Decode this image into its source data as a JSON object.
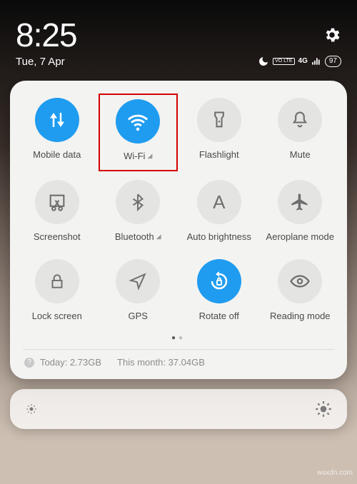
{
  "status": {
    "time": "8:25",
    "date": "Tue, 7 Apr",
    "volte": "VO LTE",
    "signal": "4G",
    "battery": "97"
  },
  "tiles": [
    {
      "label": "Mobile data",
      "active": true,
      "expand": false,
      "highlight": false
    },
    {
      "label": "Wi-Fi",
      "active": true,
      "expand": true,
      "highlight": true
    },
    {
      "label": "Flashlight",
      "active": false,
      "expand": false,
      "highlight": false
    },
    {
      "label": "Mute",
      "active": false,
      "expand": false,
      "highlight": false
    },
    {
      "label": "Screenshot",
      "active": false,
      "expand": false,
      "highlight": false
    },
    {
      "label": "Bluetooth",
      "active": false,
      "expand": true,
      "highlight": false
    },
    {
      "label": "Auto brightness",
      "active": false,
      "expand": false,
      "highlight": false
    },
    {
      "label": "Aeroplane mode",
      "active": false,
      "expand": false,
      "highlight": false
    },
    {
      "label": "Lock screen",
      "active": false,
      "expand": false,
      "highlight": false
    },
    {
      "label": "GPS",
      "active": false,
      "expand": false,
      "highlight": false
    },
    {
      "label": "Rotate off",
      "active": true,
      "expand": false,
      "highlight": false
    },
    {
      "label": "Reading mode",
      "active": false,
      "expand": false,
      "highlight": false
    }
  ],
  "usage": {
    "today_label": "Today:",
    "today_value": "2.73GB",
    "month_label": "This month:",
    "month_value": "37.04GB"
  },
  "watermark": "wsxdn.com"
}
